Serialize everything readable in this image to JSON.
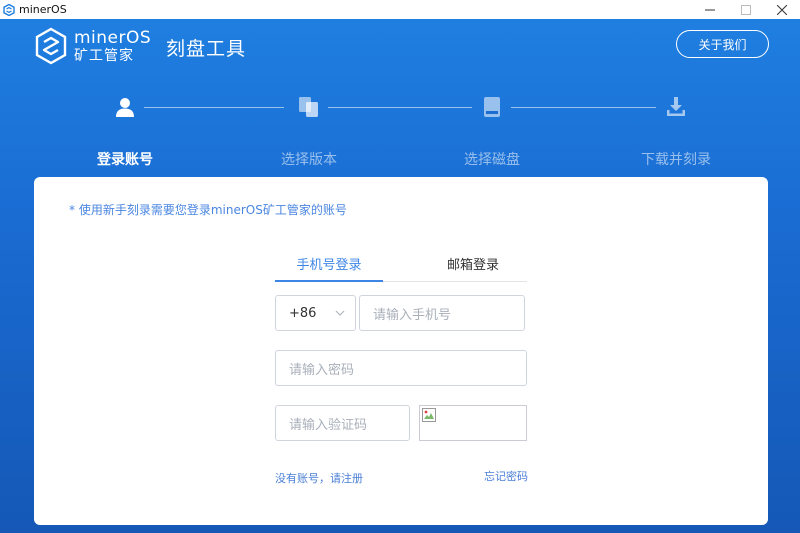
{
  "window": {
    "app_name": "minerOS",
    "controls": [
      "minimize",
      "maximize",
      "close"
    ]
  },
  "header": {
    "logo_en": "minerOS",
    "logo_cn": "矿工管家",
    "title": "刻盘工具",
    "about_label": "关于我们"
  },
  "steps": [
    {
      "label": "登录账号",
      "icon": "user-icon",
      "active": true
    },
    {
      "label": "选择版本",
      "icon": "copy-icon",
      "active": false
    },
    {
      "label": "选择磁盘",
      "icon": "disk-icon",
      "active": false
    },
    {
      "label": "下载并刻录",
      "icon": "download-icon",
      "active": false
    }
  ],
  "card": {
    "notice": "* 使用新手刻录需要您登录minerOS矿工管家的账号",
    "tabs": [
      {
        "label": "手机号登录",
        "active": true
      },
      {
        "label": "邮箱登录",
        "active": false
      }
    ],
    "country_code": "+86",
    "phone_placeholder": "请输入手机号",
    "password_placeholder": "请输入密码",
    "captcha_placeholder": "请输入验证码",
    "register_link": "没有账号，请注册",
    "forgot_link": "忘记密码"
  },
  "colors": {
    "header_blue": "#1f7fe0",
    "accent": "#3d86e6",
    "link": "#4a7fd6"
  }
}
